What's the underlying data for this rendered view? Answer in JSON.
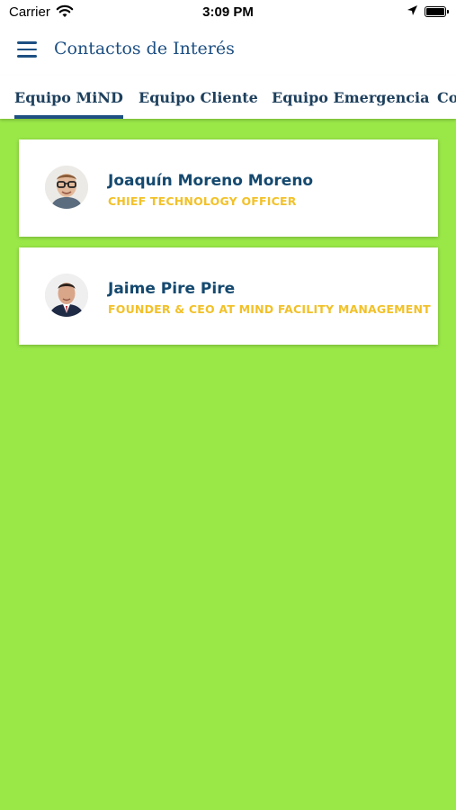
{
  "status_bar": {
    "carrier": "Carrier",
    "time": "3:09 PM"
  },
  "header": {
    "title": "Contactos de Interés",
    "icon": "menu-icon"
  },
  "tabs": [
    {
      "label": "Equipo MiND",
      "active": true
    },
    {
      "label": "Equipo Cliente",
      "active": false
    },
    {
      "label": "Equipo Emergencia",
      "active": false
    },
    {
      "label": "Co",
      "active": false
    }
  ],
  "contacts": [
    {
      "name": "Joaquín Moreno Moreno",
      "role": "CHIEF TECHNOLOGY OFFICER"
    },
    {
      "name": "Jaime Pire Pire",
      "role": "FOUNDER & CEO AT MIND FACILITY MANAGEMENT"
    }
  ],
  "colors": {
    "background": "#9ae848",
    "primary": "#1d4f82",
    "accent": "#f2c129"
  }
}
